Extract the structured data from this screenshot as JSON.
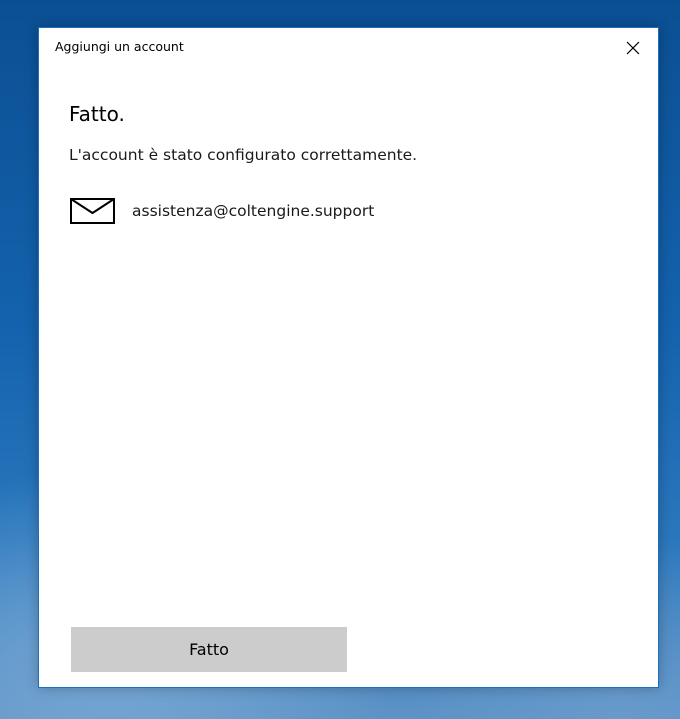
{
  "window": {
    "title": "Aggiungi un account",
    "close_icon": "close-icon"
  },
  "content": {
    "heading": "Fatto.",
    "message": "L'account è stato configurato correttamente.",
    "account": {
      "icon": "mail-icon",
      "email": "assistenza@coltengine.support"
    }
  },
  "footer": {
    "done_label": "Fatto"
  },
  "colors": {
    "button_bg": "#cccccc",
    "dialog_border": "#1b6fc0"
  }
}
